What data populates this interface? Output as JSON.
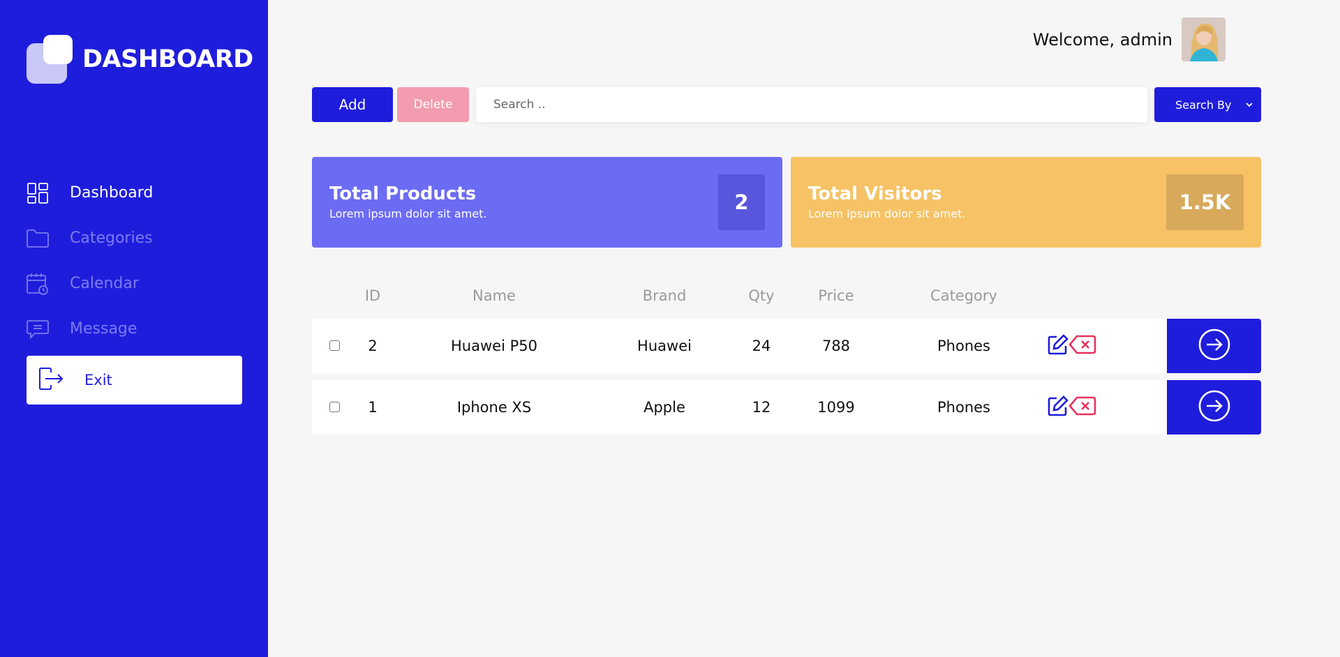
{
  "sidebar": {
    "logo_text": "DASHBOARD",
    "items": [
      {
        "label": "Dashboard",
        "icon": "dashboard-grid-icon",
        "active": true
      },
      {
        "label": "Categories",
        "icon": "folder-icon",
        "active": false
      },
      {
        "label": "Calendar",
        "icon": "calendar-icon",
        "active": false
      },
      {
        "label": "Message",
        "icon": "message-icon",
        "active": false
      }
    ],
    "exit_label": "Exit",
    "exit_icon": "logout-icon"
  },
  "header": {
    "welcome_text": "Welcome, admin",
    "avatar": "user-avatar"
  },
  "toolbar": {
    "add_label": "Add",
    "delete_label": "Delete",
    "search_placeholder": "Search ..",
    "search_by_label": "Search By"
  },
  "cards": [
    {
      "title": "Total Products",
      "subtitle": "Lorem ipsum dolor sit amet.",
      "value": "2"
    },
    {
      "title": "Total Visitors",
      "subtitle": "Lorem ipsum dolor sit amet.",
      "value": "1.5K"
    }
  ],
  "table": {
    "columns": [
      "ID",
      "Name",
      "Brand",
      "Qty",
      "Price",
      "Category"
    ],
    "rows": [
      {
        "id": "2",
        "name": "Huawei P50",
        "brand": "Huawei",
        "qty": "24",
        "price": "788",
        "category": "Phones"
      },
      {
        "id": "1",
        "name": "Iphone XS",
        "brand": "Apple",
        "qty": "12",
        "price": "1099",
        "category": "Phones"
      }
    ]
  },
  "colors": {
    "primary": "#1f1ddc",
    "sidebar_inactive": "#7d7cf0",
    "products_card": "#6c6bf4",
    "visitors_card": "#f6c265",
    "delete_button": "#f39bb0",
    "delete_icon": "#e8315b",
    "background": "#f6f6f6"
  }
}
